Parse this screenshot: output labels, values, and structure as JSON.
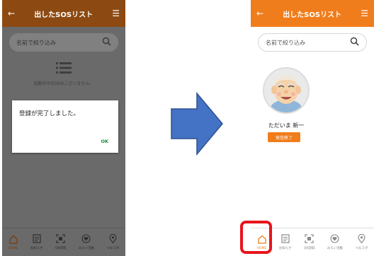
{
  "left": {
    "header": {
      "back_icon": "←",
      "title": "出したSOSリスト",
      "menu_icon": "☰"
    },
    "search": {
      "placeholder": "名前で絞り込み",
      "icon": "search-icon"
    },
    "empty_state": {
      "icon": "list-icon",
      "text": "起動中のSOSはございません。"
    },
    "dialog": {
      "message": "登録が完了しました。",
      "ok_label": "OK"
    },
    "tabs": [
      {
        "label": "HOME",
        "icon": "home-icon"
      },
      {
        "label": "お知らせ",
        "icon": "notice-icon"
      },
      {
        "label": "QR読取",
        "icon": "qr-icon"
      },
      {
        "label": "みらい活動",
        "icon": "heart-icon"
      },
      {
        "label": "つなスポ",
        "icon": "pin-icon"
      }
    ]
  },
  "right": {
    "header": {
      "back_icon": "←",
      "title": "出したSOSリスト",
      "menu_icon": "☰"
    },
    "search": {
      "placeholder": "名前で絞り込み",
      "icon": "search-icon"
    },
    "person": {
      "name": "ただいま 新一",
      "button_label": "発信終了"
    },
    "tabs": [
      {
        "label": "HOME",
        "icon": "home-icon"
      },
      {
        "label": "お知らせ",
        "icon": "notice-icon"
      },
      {
        "label": "QR読取",
        "icon": "qr-icon"
      },
      {
        "label": "みらい活動",
        "icon": "heart-icon"
      },
      {
        "label": "つなスポ",
        "icon": "pin-icon"
      }
    ]
  },
  "colors": {
    "accent": "#f07d1c",
    "dim_header": "#8c4a12",
    "arrow": "#4472c4",
    "highlight": "#e8141b"
  }
}
